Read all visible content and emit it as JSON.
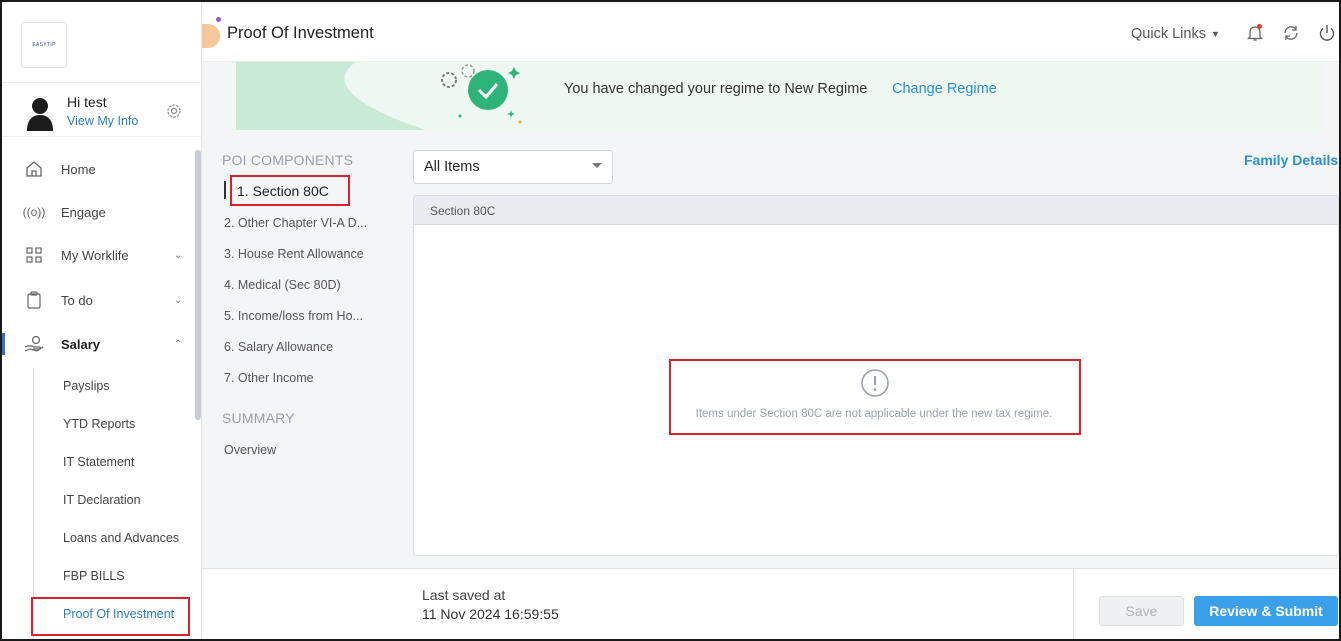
{
  "app": {
    "logo_text": "EASYTIP"
  },
  "header": {
    "title": "Proof Of Investment",
    "quick_links": "Quick Links"
  },
  "user": {
    "greeting": "Hi test",
    "view_info": "View My Info"
  },
  "nav": {
    "items": [
      {
        "label": "Home",
        "icon": "home-icon"
      },
      {
        "label": "Engage",
        "icon": "broadcast-icon"
      },
      {
        "label": "My Worklife",
        "icon": "grid-icon"
      },
      {
        "label": "To do",
        "icon": "clipboard-icon"
      },
      {
        "label": "Salary",
        "icon": "hand-coin-icon"
      }
    ],
    "salary_sub": [
      "Payslips",
      "YTD Reports",
      "IT Statement",
      "IT Declaration",
      "Loans and Advances",
      "FBP BILLS",
      "Proof Of Investment"
    ]
  },
  "banner": {
    "message": "You have changed your regime to New Regime",
    "link": "Change Regime"
  },
  "poi": {
    "heading": "POI COMPONENTS",
    "items": [
      "1. Section 80C",
      "2. Other Chapter VI-A D...",
      "3. House Rent Allowance",
      "4. Medical (Sec 80D)",
      "5. Income/loss from Ho...",
      "6. Salary Allowance",
      "7. Other Income"
    ],
    "summary_heading": "SUMMARY",
    "summary_items": [
      "Overview"
    ]
  },
  "filter": {
    "selected": "All Items"
  },
  "family_details": "Family Details",
  "panel": {
    "heading": "Section 80C",
    "empty_message": "Items under Section 80C are not applicable under the new tax regime."
  },
  "footer": {
    "last_saved_label": "Last saved at",
    "last_saved_value": "11 Nov 2024 16:59:55",
    "save": "Save",
    "submit": "Review & Submit"
  },
  "colors": {
    "accent": "#2b8fd6",
    "primary_button": "#3aa0ea",
    "banner_bg": "#eef8f1",
    "highlight": "#d9222a"
  }
}
